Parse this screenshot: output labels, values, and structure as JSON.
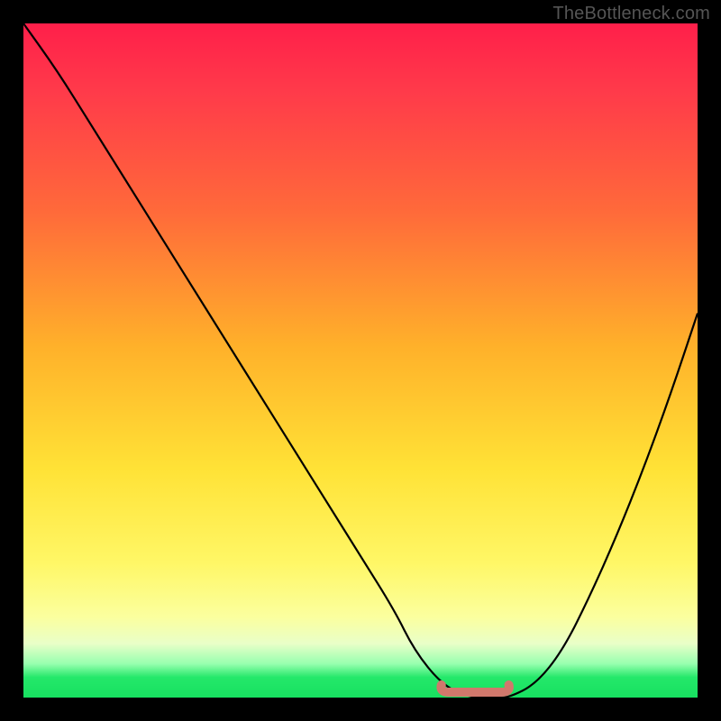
{
  "attribution": "TheBottleneck.com",
  "chart_data": {
    "type": "line",
    "title": "",
    "xlabel": "",
    "ylabel": "",
    "xlim": [
      0,
      100
    ],
    "ylim": [
      0,
      100
    ],
    "series": [
      {
        "name": "bottleneck-curve",
        "x": [
          0,
          5,
          10,
          15,
          20,
          25,
          30,
          35,
          40,
          45,
          50,
          55,
          58,
          62,
          66,
          70,
          72,
          76,
          80,
          84,
          88,
          92,
          96,
          100
        ],
        "y": [
          100,
          93,
          85,
          77,
          69,
          61,
          53,
          45,
          37,
          29,
          21,
          13,
          7,
          2,
          0,
          0,
          0,
          2,
          7,
          15,
          24,
          34,
          45,
          57
        ]
      }
    ],
    "background_gradient": {
      "stops": [
        {
          "pos": 0.0,
          "color": "#ff1f4a"
        },
        {
          "pos": 0.1,
          "color": "#ff3a4a"
        },
        {
          "pos": 0.28,
          "color": "#ff6a3a"
        },
        {
          "pos": 0.48,
          "color": "#ffb12a"
        },
        {
          "pos": 0.66,
          "color": "#ffe236"
        },
        {
          "pos": 0.8,
          "color": "#fff766"
        },
        {
          "pos": 0.88,
          "color": "#fbff9e"
        },
        {
          "pos": 0.92,
          "color": "#e9ffc8"
        },
        {
          "pos": 0.95,
          "color": "#97ffaf"
        },
        {
          "pos": 0.97,
          "color": "#24e86a"
        },
        {
          "pos": 1.0,
          "color": "#17e060"
        }
      ]
    },
    "optimal_zone": {
      "x_start": 62,
      "x_end": 72,
      "y": 0,
      "color": "#d1786c"
    }
  }
}
